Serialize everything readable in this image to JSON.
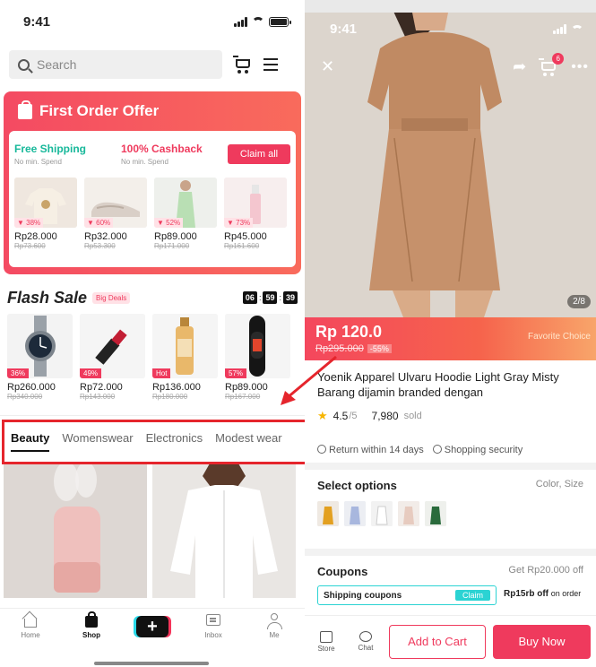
{
  "left": {
    "status_time": "9:41",
    "search_placeholder": "Search",
    "first_order": {
      "title": "First Order Offer",
      "free_shipping": "Free Shipping",
      "free_shipping_sub": "No min. Spend",
      "cashback": "100% Cashback",
      "cashback_sub": "No min. Spend",
      "claim_all": "Claim all",
      "products": [
        {
          "discount": "38%",
          "price": "Rp28.000",
          "orig": "Rp73.600"
        },
        {
          "discount": "60%",
          "price": "Rp32.000",
          "orig": "Rp53.300"
        },
        {
          "discount": "52%",
          "price": "Rp89.000",
          "orig": "Rp171.000"
        },
        {
          "discount": "73%",
          "price": "Rp45.000",
          "orig": "Rp161.600"
        }
      ]
    },
    "flash": {
      "title": "Flash Sale",
      "tag": "Big Deals",
      "timer": [
        "06",
        "59",
        "39"
      ],
      "products": [
        {
          "badge": "36%",
          "price": "Rp260.000",
          "orig": "Rp340.000"
        },
        {
          "badge": "49%",
          "price": "Rp72.000",
          "orig": "Rp143.000"
        },
        {
          "badge": "Hot",
          "price": "Rp136.000",
          "orig": "Rp180.000"
        },
        {
          "badge": "57%",
          "price": "Rp89.000",
          "orig": "Rp167.000"
        }
      ]
    },
    "tabs": [
      "Beauty",
      "Womenswear",
      "Electronics",
      "Modest wear"
    ],
    "bottom_nav": [
      "Home",
      "Shop",
      "+",
      "Inbox",
      "Me"
    ]
  },
  "right": {
    "status_time": "9:41",
    "cart_badge": "6",
    "pager": "2/8",
    "price_now": "Rp 120.0",
    "price_was": "Rp295.000",
    "price_off": "-55%",
    "favorite_choice": "Favorite Choice",
    "title": "Yoenik Apparel Ulvaru Hoodie Light Gray Misty Barang dijamin branded dengan",
    "rating": "4.5",
    "rating_max": "/5",
    "sold_count": "7,980",
    "sold_label": "sold",
    "guarantee_1": "Return within 14 days",
    "guarantee_2": "Shopping security",
    "select_options": "Select options",
    "select_sub": "Color, Size",
    "coupons": "Coupons",
    "coupons_sub": "Get Rp20.000 off",
    "coupon_1": "Shipping coupons",
    "coupon_1_claim": "Claim",
    "coupon_2": "Rp15rb off",
    "coupon_2_sub": "on order",
    "store": "Store",
    "chat": "Chat",
    "add_to_cart": "Add to Cart",
    "buy_now": "Buy Now"
  },
  "colors": {
    "accent": "#ef3a5d",
    "teal": "#17b89a",
    "highlight_red": "#e5252c"
  }
}
